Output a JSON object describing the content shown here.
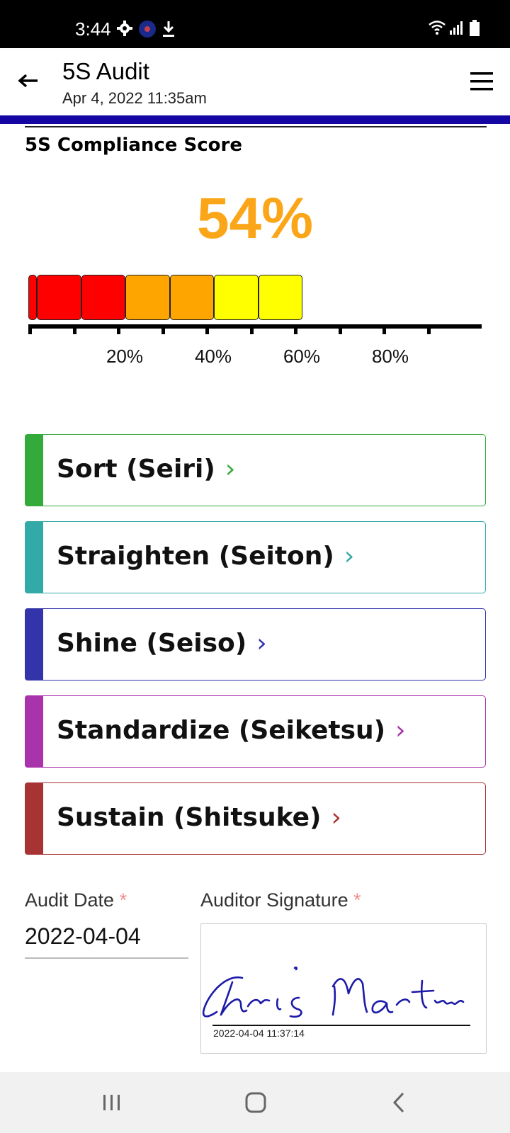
{
  "status_bar": {
    "time": "3:44",
    "icons": [
      "settings-icon",
      "app-icon",
      "download-icon",
      "wifi-icon",
      "signal-icon",
      "battery-icon"
    ]
  },
  "app_bar": {
    "title": "5S Audit",
    "subtitle": "Apr 4, 2022 11:35am",
    "accent_color": "#1306a3"
  },
  "score": {
    "heading": "5S Compliance Score",
    "value_text": "54%",
    "value": 54,
    "color": "#fba619",
    "scale_labels": [
      "20%",
      "40%",
      "60%",
      "80%"
    ],
    "segment_colors": [
      "#ff0000",
      "#ff0000",
      "#ff0000",
      "#ffa500",
      "#ffa500",
      "#ffff00",
      "#ffff00"
    ]
  },
  "sections": [
    {
      "label": "Sort (Seiri)",
      "chevron": "›",
      "color": "#33aa3a"
    },
    {
      "label": "Straighten (Seiton)",
      "chevron": "›",
      "color": "#33aaa8"
    },
    {
      "label": "Shine (Seiso)",
      "chevron": "›",
      "color": "#3333aa"
    },
    {
      "label": "Standardize (Seiketsu)",
      "chevron": "›",
      "color": "#a833aa"
    },
    {
      "label": "Sustain (Shitsuke)",
      "chevron": "›",
      "color": "#a83333"
    }
  ],
  "form": {
    "audit_date_label": "Audit Date",
    "audit_date_value": "2022-04-04",
    "signature_label": "Auditor Signature",
    "required_mark": "*",
    "signature_name": "Chris Martin",
    "signature_timestamp": "2022-04-04 11:37:14"
  },
  "nav_bar": {
    "buttons": [
      "recent-apps-icon",
      "home-icon",
      "back-icon"
    ]
  }
}
